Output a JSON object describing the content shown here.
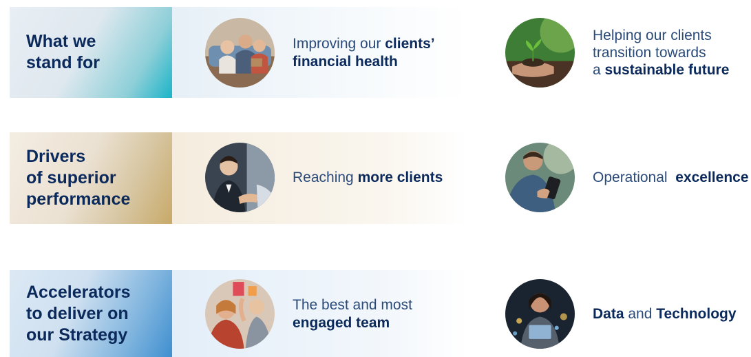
{
  "rows": [
    {
      "label": "What we\nstand for",
      "items": [
        {
          "photo": "family-on-couch-photo",
          "parts": [
            "Improving our ",
            "clients’",
            "\n",
            "financial health"
          ]
        },
        {
          "photo": "seedling-in-hands-photo",
          "parts": [
            "Helping our clients\ntransition towards\na ",
            "sustainable future"
          ]
        }
      ]
    },
    {
      "label": "Drivers\nof superior\nperformance",
      "items": [
        {
          "photo": "handshake-meeting-photo",
          "parts": [
            "Reaching ",
            "more clients"
          ]
        },
        {
          "photo": "man-using-smartphone-photo",
          "parts": [
            "Operational  ",
            "excellence"
          ]
        }
      ]
    },
    {
      "label": "Accelerators\nto deliver on\nour Strategy",
      "items": [
        {
          "photo": "team-celebrating-photo",
          "parts": [
            "The best and most\n",
            "engaged team"
          ]
        },
        {
          "photo": "woman-with-data-lights-photo",
          "parts": [
            "Data",
            " and ",
            "Technology"
          ]
        }
      ]
    }
  ],
  "colors": {
    "navy_text": "#0b2a5b",
    "teal_accent": "#1bb4c8",
    "gold_accent": "#c8a968",
    "blue_accent": "#3f8fd0"
  }
}
